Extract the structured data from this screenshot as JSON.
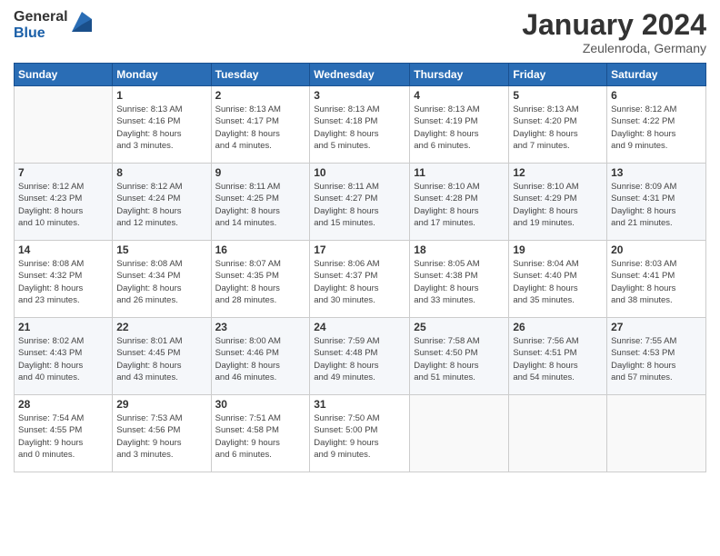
{
  "logo": {
    "general": "General",
    "blue": "Blue"
  },
  "header": {
    "month": "January 2024",
    "location": "Zeulenroda, Germany"
  },
  "weekdays": [
    "Sunday",
    "Monday",
    "Tuesday",
    "Wednesday",
    "Thursday",
    "Friday",
    "Saturday"
  ],
  "weeks": [
    [
      {
        "day": "",
        "info": ""
      },
      {
        "day": "1",
        "info": "Sunrise: 8:13 AM\nSunset: 4:16 PM\nDaylight: 8 hours\nand 3 minutes."
      },
      {
        "day": "2",
        "info": "Sunrise: 8:13 AM\nSunset: 4:17 PM\nDaylight: 8 hours\nand 4 minutes."
      },
      {
        "day": "3",
        "info": "Sunrise: 8:13 AM\nSunset: 4:18 PM\nDaylight: 8 hours\nand 5 minutes."
      },
      {
        "day": "4",
        "info": "Sunrise: 8:13 AM\nSunset: 4:19 PM\nDaylight: 8 hours\nand 6 minutes."
      },
      {
        "day": "5",
        "info": "Sunrise: 8:13 AM\nSunset: 4:20 PM\nDaylight: 8 hours\nand 7 minutes."
      },
      {
        "day": "6",
        "info": "Sunrise: 8:12 AM\nSunset: 4:22 PM\nDaylight: 8 hours\nand 9 minutes."
      }
    ],
    [
      {
        "day": "7",
        "info": "Sunrise: 8:12 AM\nSunset: 4:23 PM\nDaylight: 8 hours\nand 10 minutes."
      },
      {
        "day": "8",
        "info": "Sunrise: 8:12 AM\nSunset: 4:24 PM\nDaylight: 8 hours\nand 12 minutes."
      },
      {
        "day": "9",
        "info": "Sunrise: 8:11 AM\nSunset: 4:25 PM\nDaylight: 8 hours\nand 14 minutes."
      },
      {
        "day": "10",
        "info": "Sunrise: 8:11 AM\nSunset: 4:27 PM\nDaylight: 8 hours\nand 15 minutes."
      },
      {
        "day": "11",
        "info": "Sunrise: 8:10 AM\nSunset: 4:28 PM\nDaylight: 8 hours\nand 17 minutes."
      },
      {
        "day": "12",
        "info": "Sunrise: 8:10 AM\nSunset: 4:29 PM\nDaylight: 8 hours\nand 19 minutes."
      },
      {
        "day": "13",
        "info": "Sunrise: 8:09 AM\nSunset: 4:31 PM\nDaylight: 8 hours\nand 21 minutes."
      }
    ],
    [
      {
        "day": "14",
        "info": "Sunrise: 8:08 AM\nSunset: 4:32 PM\nDaylight: 8 hours\nand 23 minutes."
      },
      {
        "day": "15",
        "info": "Sunrise: 8:08 AM\nSunset: 4:34 PM\nDaylight: 8 hours\nand 26 minutes."
      },
      {
        "day": "16",
        "info": "Sunrise: 8:07 AM\nSunset: 4:35 PM\nDaylight: 8 hours\nand 28 minutes."
      },
      {
        "day": "17",
        "info": "Sunrise: 8:06 AM\nSunset: 4:37 PM\nDaylight: 8 hours\nand 30 minutes."
      },
      {
        "day": "18",
        "info": "Sunrise: 8:05 AM\nSunset: 4:38 PM\nDaylight: 8 hours\nand 33 minutes."
      },
      {
        "day": "19",
        "info": "Sunrise: 8:04 AM\nSunset: 4:40 PM\nDaylight: 8 hours\nand 35 minutes."
      },
      {
        "day": "20",
        "info": "Sunrise: 8:03 AM\nSunset: 4:41 PM\nDaylight: 8 hours\nand 38 minutes."
      }
    ],
    [
      {
        "day": "21",
        "info": "Sunrise: 8:02 AM\nSunset: 4:43 PM\nDaylight: 8 hours\nand 40 minutes."
      },
      {
        "day": "22",
        "info": "Sunrise: 8:01 AM\nSunset: 4:45 PM\nDaylight: 8 hours\nand 43 minutes."
      },
      {
        "day": "23",
        "info": "Sunrise: 8:00 AM\nSunset: 4:46 PM\nDaylight: 8 hours\nand 46 minutes."
      },
      {
        "day": "24",
        "info": "Sunrise: 7:59 AM\nSunset: 4:48 PM\nDaylight: 8 hours\nand 49 minutes."
      },
      {
        "day": "25",
        "info": "Sunrise: 7:58 AM\nSunset: 4:50 PM\nDaylight: 8 hours\nand 51 minutes."
      },
      {
        "day": "26",
        "info": "Sunrise: 7:56 AM\nSunset: 4:51 PM\nDaylight: 8 hours\nand 54 minutes."
      },
      {
        "day": "27",
        "info": "Sunrise: 7:55 AM\nSunset: 4:53 PM\nDaylight: 8 hours\nand 57 minutes."
      }
    ],
    [
      {
        "day": "28",
        "info": "Sunrise: 7:54 AM\nSunset: 4:55 PM\nDaylight: 9 hours\nand 0 minutes."
      },
      {
        "day": "29",
        "info": "Sunrise: 7:53 AM\nSunset: 4:56 PM\nDaylight: 9 hours\nand 3 minutes."
      },
      {
        "day": "30",
        "info": "Sunrise: 7:51 AM\nSunset: 4:58 PM\nDaylight: 9 hours\nand 6 minutes."
      },
      {
        "day": "31",
        "info": "Sunrise: 7:50 AM\nSunset: 5:00 PM\nDaylight: 9 hours\nand 9 minutes."
      },
      {
        "day": "",
        "info": ""
      },
      {
        "day": "",
        "info": ""
      },
      {
        "day": "",
        "info": ""
      }
    ]
  ]
}
